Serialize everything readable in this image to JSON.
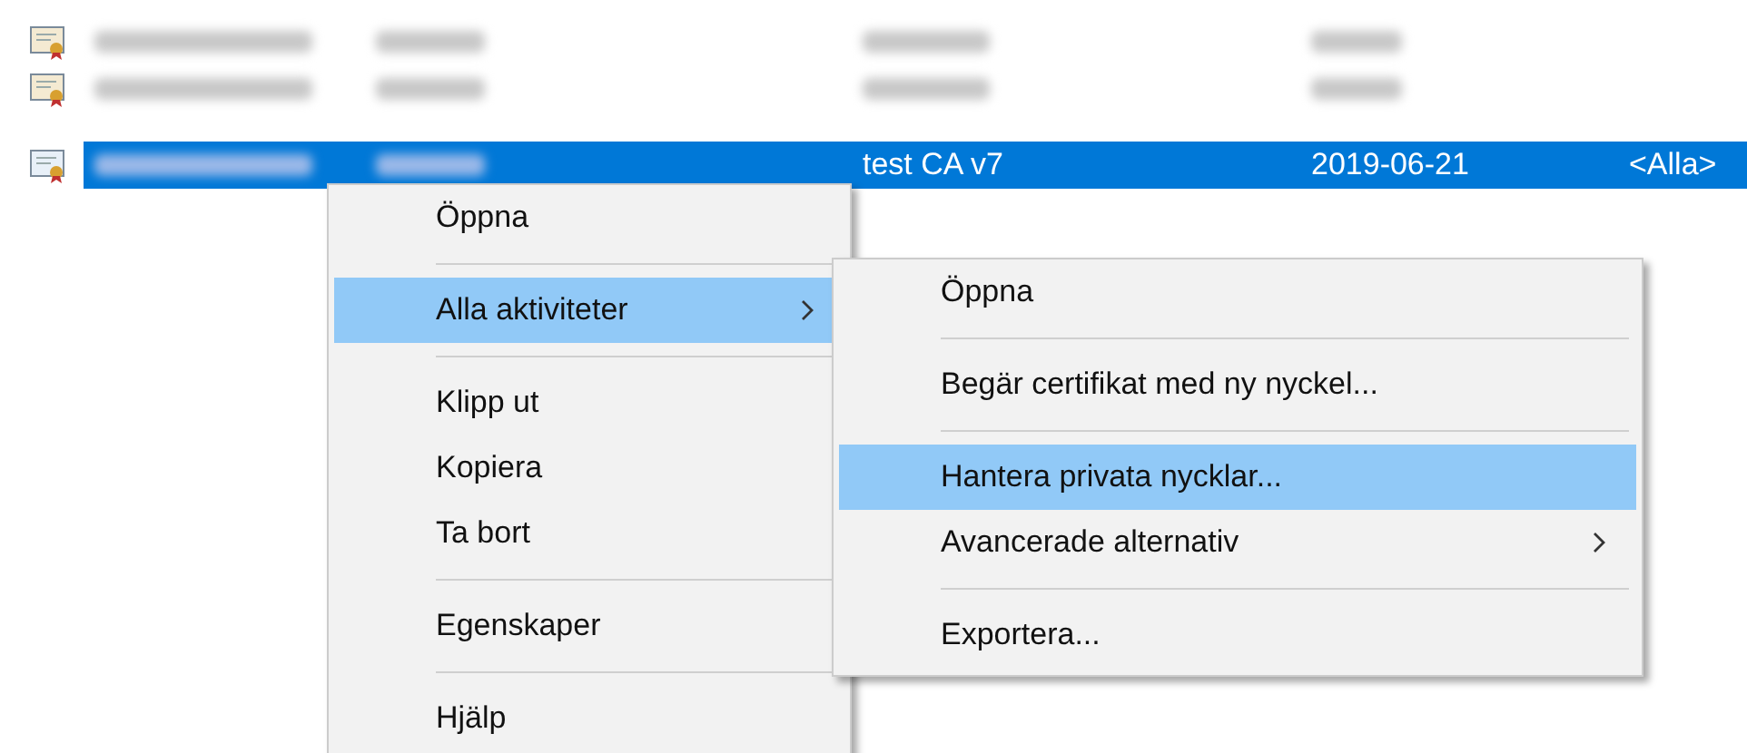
{
  "list": {
    "rows": [
      {
        "selected": false,
        "cells": [
          {
            "kind": "blurred"
          },
          {
            "kind": "blurred"
          },
          {
            "kind": "blurred"
          },
          {
            "kind": "blurred"
          }
        ]
      },
      {
        "selected": false,
        "cells": [
          {
            "kind": "blurred"
          },
          {
            "kind": "blurred"
          },
          {
            "kind": "blurred"
          },
          {
            "kind": "blurred"
          }
        ]
      },
      {
        "selected": true,
        "cells": [
          {
            "kind": "blurred"
          },
          {
            "kind": "blurred"
          },
          {
            "kind": "text",
            "text": "test CA v7"
          },
          {
            "kind": "text",
            "text": "2019-06-21"
          },
          {
            "kind": "text",
            "text": "<Alla>"
          }
        ]
      }
    ]
  },
  "context_menu": {
    "items": [
      {
        "kind": "item",
        "label": "Öppna",
        "selected": false,
        "submenu": false
      },
      {
        "kind": "separator"
      },
      {
        "kind": "item",
        "label": "Alla aktiviteter",
        "selected": true,
        "submenu": true
      },
      {
        "kind": "separator"
      },
      {
        "kind": "item",
        "label": "Klipp ut",
        "selected": false,
        "submenu": false
      },
      {
        "kind": "item",
        "label": "Kopiera",
        "selected": false,
        "submenu": false
      },
      {
        "kind": "item",
        "label": "Ta bort",
        "selected": false,
        "submenu": false
      },
      {
        "kind": "separator"
      },
      {
        "kind": "item",
        "label": "Egenskaper",
        "selected": false,
        "submenu": false
      },
      {
        "kind": "separator"
      },
      {
        "kind": "item",
        "label": "Hjälp",
        "selected": false,
        "submenu": false
      }
    ]
  },
  "submenu": {
    "items": [
      {
        "kind": "item",
        "label": "Öppna",
        "selected": false,
        "submenu": false
      },
      {
        "kind": "separator"
      },
      {
        "kind": "item",
        "label": "Begär certifikat med ny nyckel...",
        "selected": false,
        "submenu": false
      },
      {
        "kind": "separator"
      },
      {
        "kind": "item",
        "label": "Hantera privata nycklar...",
        "selected": true,
        "submenu": false
      },
      {
        "kind": "item",
        "label": "Avancerade alternativ",
        "selected": false,
        "submenu": true
      },
      {
        "kind": "separator"
      },
      {
        "kind": "item",
        "label": "Exportera...",
        "selected": false,
        "submenu": false
      }
    ]
  }
}
